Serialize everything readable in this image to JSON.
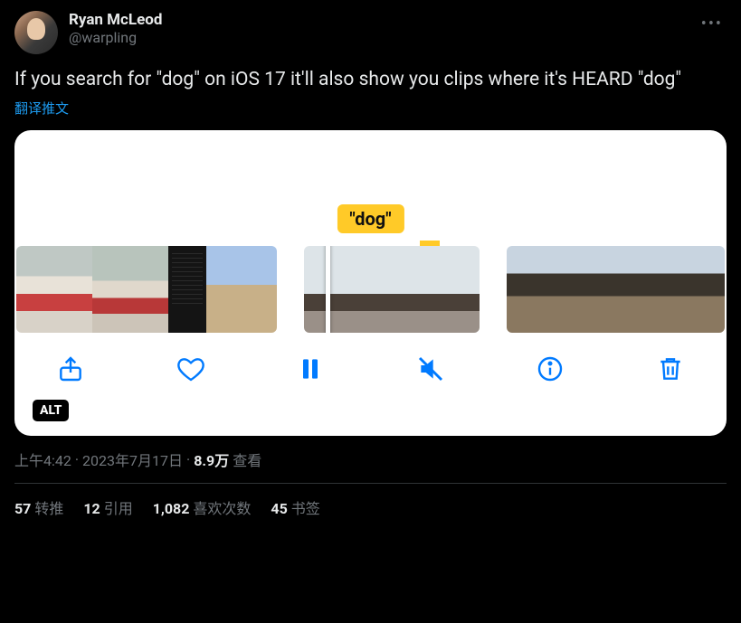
{
  "author": {
    "display_name": "Ryan McLeod",
    "handle": "@warpling"
  },
  "tweet_text": "If you search for \"dog\" on iOS 17 it'll also show you clips where it's HEARD \"dog\"",
  "translate_label": "翻译推文",
  "media": {
    "tag_text": "\"dog\"",
    "alt_badge": "ALT"
  },
  "meta": {
    "time": "上午4:42",
    "sep1": " · ",
    "date": "2023年7月17日",
    "sep2": " · ",
    "views_count": "8.9万",
    "views_label": " 查看"
  },
  "stats": {
    "retweets_count": "57",
    "retweets_label": "转推",
    "quotes_count": "12",
    "quotes_label": "引用",
    "likes_count": "1,082",
    "likes_label": "喜欢次数",
    "bookmarks_count": "45",
    "bookmarks_label": "书签"
  }
}
